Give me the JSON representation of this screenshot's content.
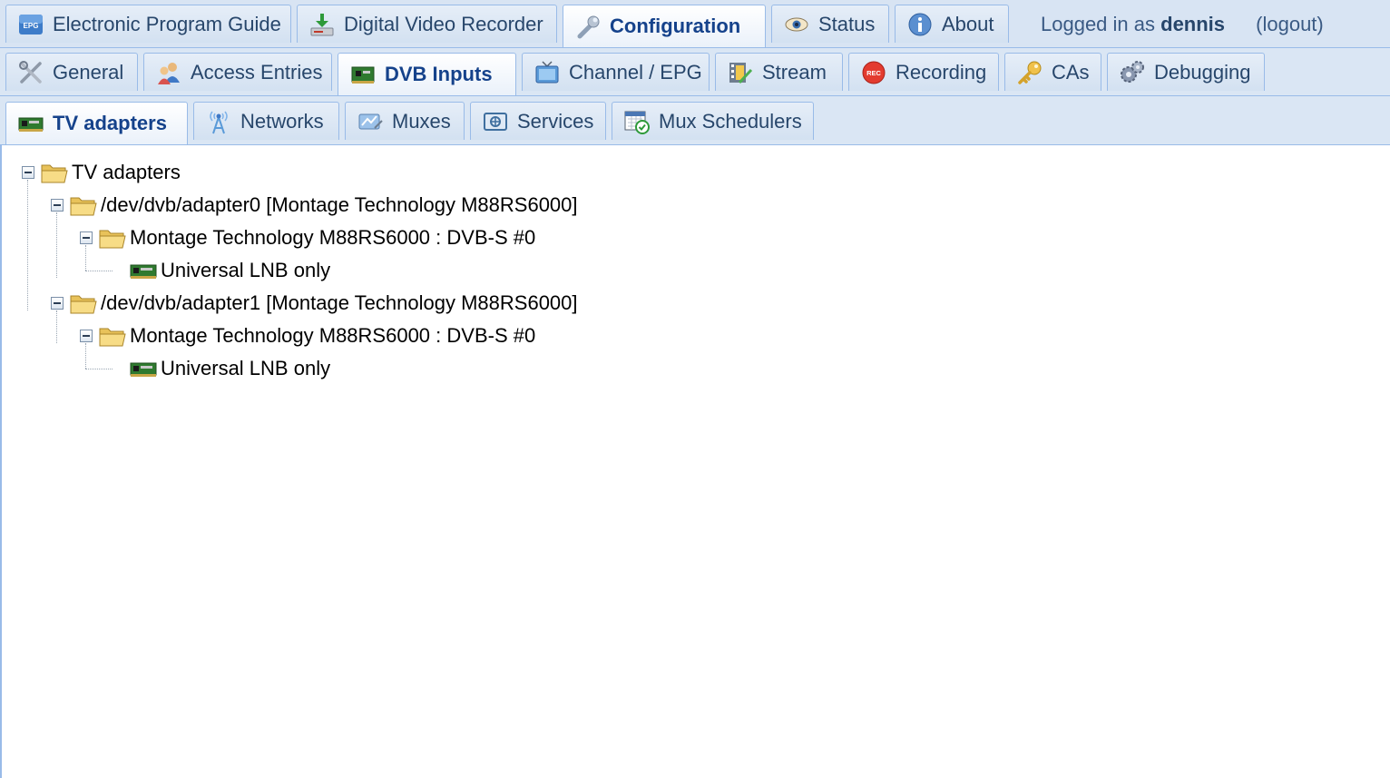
{
  "top_tabs": [
    {
      "label": "Electronic Program Guide",
      "icon": "epg-icon",
      "active": false
    },
    {
      "label": "Digital Video Recorder",
      "icon": "download-icon",
      "active": false
    },
    {
      "label": "Configuration",
      "icon": "wrench-icon",
      "active": true
    },
    {
      "label": "Status",
      "icon": "eye-icon",
      "active": false
    },
    {
      "label": "About",
      "icon": "info-icon",
      "active": false
    }
  ],
  "login": {
    "prefix": "Logged in as",
    "user": "dennis",
    "logout_label": "(logout)"
  },
  "config_tabs": [
    {
      "label": "General",
      "icon": "tools-icon",
      "active": false
    },
    {
      "label": "Access Entries",
      "icon": "users-icon",
      "active": false
    },
    {
      "label": "DVB Inputs",
      "icon": "tuner-card-icon",
      "active": true
    },
    {
      "label": "Channel / EPG",
      "icon": "tv-icon",
      "active": false
    },
    {
      "label": "Stream",
      "icon": "stream-icon",
      "active": false
    },
    {
      "label": "Recording",
      "icon": "rec-icon",
      "active": false
    },
    {
      "label": "CAs",
      "icon": "key-icon",
      "active": false
    },
    {
      "label": "Debugging",
      "icon": "gears-icon",
      "active": false
    }
  ],
  "dvb_tabs": [
    {
      "label": "TV adapters",
      "icon": "tuner-card-icon",
      "active": true
    },
    {
      "label": "Networks",
      "icon": "antenna-icon",
      "active": false
    },
    {
      "label": "Muxes",
      "icon": "mux-icon",
      "active": false
    },
    {
      "label": "Services",
      "icon": "services-icon",
      "active": false
    },
    {
      "label": "Mux Schedulers",
      "icon": "calendar-icon",
      "active": false
    }
  ],
  "tree": {
    "root": "TV adapters",
    "adapter0": "/dev/dvb/adapter0 [Montage Technology M88RS6000]",
    "frontend0": "Montage Technology M88RS6000 : DVB-S #0",
    "lnb0": "Universal LNB only",
    "adapter1": "/dev/dvb/adapter1 [Montage Technology M88RS6000]",
    "frontend1": "Montage Technology M88RS6000 : DVB-S #0",
    "lnb1": "Universal LNB only"
  },
  "colors": {
    "strip_bg": "#d8e4f3",
    "tab_border": "#99bbe8",
    "active_text": "#15428b",
    "tab_text": "#27466b"
  }
}
